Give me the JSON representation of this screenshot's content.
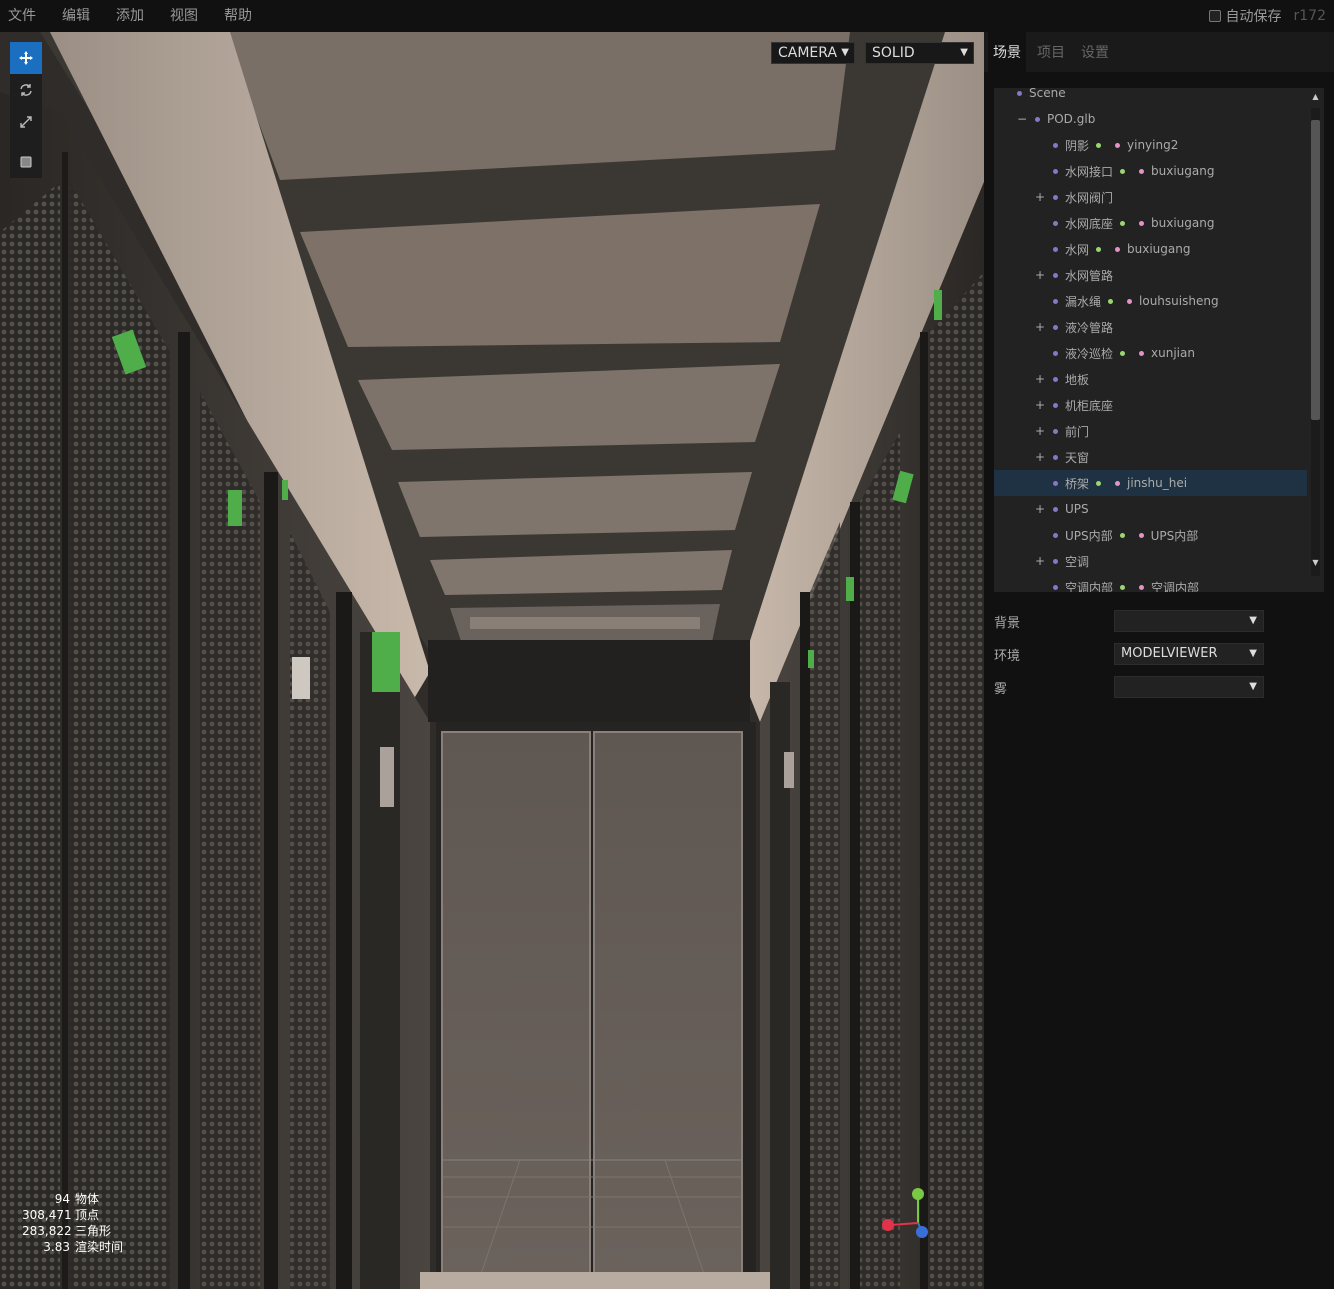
{
  "menubar": {
    "items": [
      "文件",
      "编辑",
      "添加",
      "视图",
      "帮助"
    ],
    "autosave_label": "自动保存",
    "version": "r172"
  },
  "viewport": {
    "camera_select": "CAMERA",
    "shading_select": "SOLID",
    "tools": [
      "translate-icon",
      "rotate-icon",
      "scale-icon",
      "local-icon"
    ],
    "info": [
      {
        "value": "94",
        "label": "物体"
      },
      {
        "value": "308,471",
        "label": "顶点"
      },
      {
        "value": "283,822",
        "label": "三角形"
      },
      {
        "value": "3.83",
        "label": "渲染时间"
      }
    ],
    "axis_colors": {
      "x": "#e2334a",
      "y": "#7ac943",
      "z": "#3a6fd8"
    }
  },
  "sidebar": {
    "tabs": [
      "场景",
      "项目",
      "设置"
    ],
    "active_tab": "场景",
    "outliner": [
      {
        "opener": "",
        "name": "Scene",
        "indent": 0,
        "mesh_dot": false,
        "material": ""
      },
      {
        "opener": "−",
        "name": "POD.glb",
        "indent": 1,
        "mesh_dot": false,
        "material": ""
      },
      {
        "opener": "",
        "name": "阴影",
        "indent": 2,
        "mesh_dot": true,
        "material": "yinying2"
      },
      {
        "opener": "",
        "name": "水网接口",
        "indent": 2,
        "mesh_dot": true,
        "material": "buxiugang"
      },
      {
        "opener": "+",
        "name": "水网阀门",
        "indent": 2,
        "mesh_dot": false,
        "material": ""
      },
      {
        "opener": "",
        "name": "水网底座",
        "indent": 2,
        "mesh_dot": true,
        "material": "buxiugang"
      },
      {
        "opener": "",
        "name": "水网",
        "indent": 2,
        "mesh_dot": true,
        "material": "buxiugang"
      },
      {
        "opener": "+",
        "name": "水网管路",
        "indent": 2,
        "mesh_dot": false,
        "material": ""
      },
      {
        "opener": "",
        "name": "漏水绳",
        "indent": 2,
        "mesh_dot": true,
        "material": "louhsuisheng"
      },
      {
        "opener": "+",
        "name": "液冷管路",
        "indent": 2,
        "mesh_dot": false,
        "material": ""
      },
      {
        "opener": "",
        "name": "液冷巡检",
        "indent": 2,
        "mesh_dot": true,
        "material": "xunjian"
      },
      {
        "opener": "+",
        "name": "地板",
        "indent": 2,
        "mesh_dot": false,
        "material": ""
      },
      {
        "opener": "+",
        "name": "机柜底座",
        "indent": 2,
        "mesh_dot": false,
        "material": ""
      },
      {
        "opener": "+",
        "name": "前门",
        "indent": 2,
        "mesh_dot": false,
        "material": ""
      },
      {
        "opener": "+",
        "name": "天窗",
        "indent": 2,
        "mesh_dot": false,
        "material": ""
      },
      {
        "opener": "",
        "name": "桥架",
        "indent": 2,
        "mesh_dot": true,
        "material": "jinshu_hei",
        "selected": true
      },
      {
        "opener": "+",
        "name": "UPS",
        "indent": 2,
        "mesh_dot": false,
        "material": ""
      },
      {
        "opener": "",
        "name": "UPS内部",
        "indent": 2,
        "mesh_dot": true,
        "material": "UPS内部"
      },
      {
        "opener": "+",
        "name": "空调",
        "indent": 2,
        "mesh_dot": false,
        "material": ""
      },
      {
        "opener": "",
        "name": "空调内部",
        "indent": 2,
        "mesh_dot": true,
        "material": "空调内部"
      }
    ],
    "properties": {
      "background_label": "背景",
      "background_value": "",
      "environment_label": "环境",
      "environment_value": "MODELVIEWER",
      "fog_label": "雾",
      "fog_value": ""
    }
  }
}
